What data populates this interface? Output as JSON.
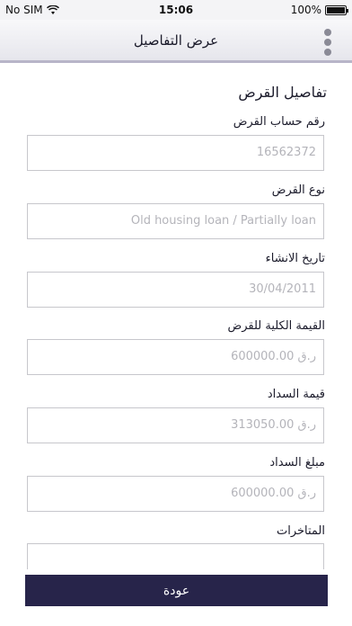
{
  "status_bar": {
    "carrier": "No SIM",
    "time": "15:06",
    "battery": "100%",
    "wifi_icon": "wifi-icon",
    "battery_icon": "battery-icon"
  },
  "nav": {
    "title": "عرض التفاصيل",
    "menu_icon": "more-vertical-icon"
  },
  "section_title": "تفاصيل القرض",
  "fields": [
    {
      "label": "رقم حساب القرض",
      "value": "16562372"
    },
    {
      "label": "نوع القرض",
      "value": "Old housing loan / Partially loan"
    },
    {
      "label": "تاريخ الانشاء",
      "value": "30/04/2011"
    },
    {
      "label": "القيمة الكلية للقرض",
      "value": "600000.00 ر.ق"
    },
    {
      "label": "قيمة السداد",
      "value": "313050.00 ر.ق"
    },
    {
      "label": "مبلغ السداد",
      "value": "600000.00 ر.ق"
    },
    {
      "label": "المتاخرات",
      "value": ""
    }
  ],
  "back_button_label": "عودة"
}
